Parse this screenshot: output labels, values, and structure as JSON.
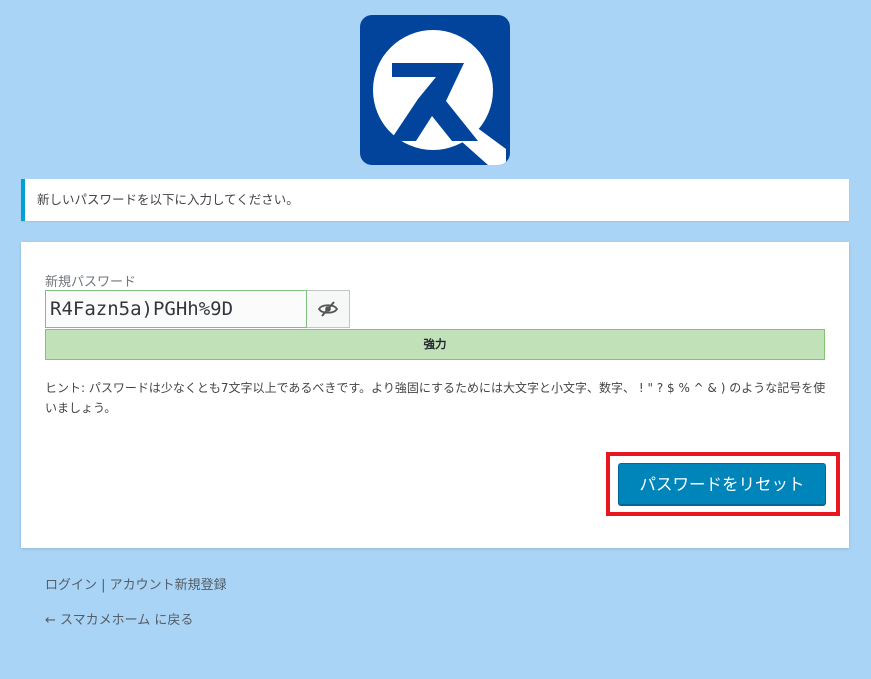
{
  "logo": {
    "letter": "ス",
    "bg_color": "#02449b"
  },
  "message": {
    "text": "新しいパスワードを以下に入力してください。",
    "accent_color": "#00a0d2"
  },
  "form": {
    "label": "新規パスワード",
    "password_value": "R4Fazn5a)PGHh%9D",
    "toggle_icon": "eye-slash-icon",
    "strength_label": "強力",
    "strength_color": "#c1e1b9",
    "hint": "ヒント: パスワードは少なくとも7文字以上であるべきです。より強固にするためには大文字と小文字、数字、 ! \" ? $ % ^ & ) のような記号を使いましょう。",
    "submit_label": "パスワードをリセット",
    "submit_color": "#0085ba",
    "highlight_color": "#e8171d"
  },
  "nav": {
    "login": "ログイン",
    "separator": " | ",
    "register": "アカウント新規登録",
    "back": "← スマカメホーム に戻る"
  }
}
